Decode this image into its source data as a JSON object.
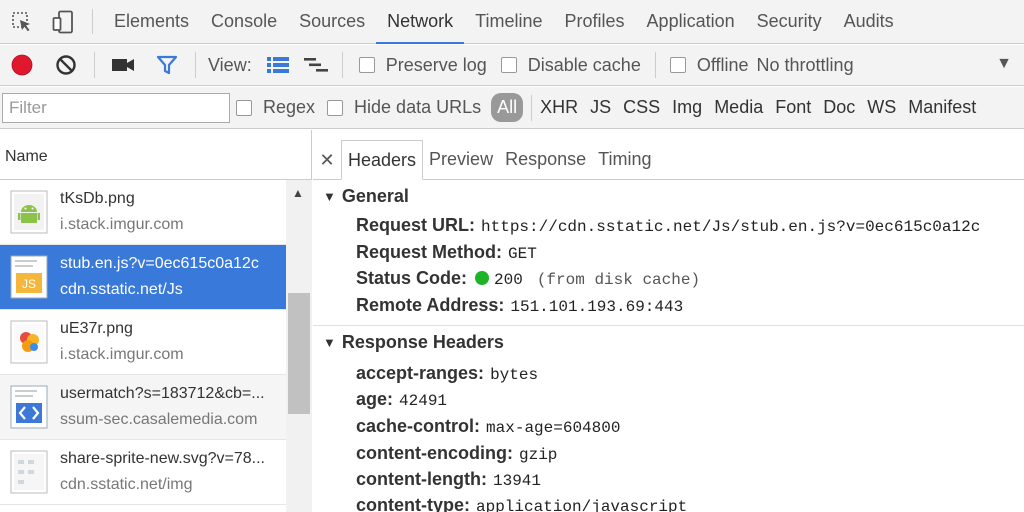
{
  "main_tabs": [
    "Elements",
    "Console",
    "Sources",
    "Network",
    "Timeline",
    "Profiles",
    "Application",
    "Security",
    "Audits"
  ],
  "toolbar": {
    "view_label": "View:",
    "preserve_log": "Preserve log",
    "disable_cache": "Disable cache",
    "offline": "Offline",
    "throttling": "No throttling"
  },
  "filter": {
    "placeholder": "Filter",
    "regex": "Regex",
    "hide_data_urls": "Hide data URLs",
    "all": "All",
    "types": [
      "XHR",
      "JS",
      "CSS",
      "Img",
      "Media",
      "Font",
      "Doc",
      "WS",
      "Manifest"
    ]
  },
  "list": {
    "header": "Name",
    "items": [
      {
        "name": "tKsDb.png",
        "domain": "i.stack.imgur.com",
        "icon": "android-image-icon"
      },
      {
        "name": "stub.en.js?v=0ec615c0a12c",
        "domain": "cdn.sstatic.net/Js",
        "icon": "js-file-icon"
      },
      {
        "name": "uE37r.png",
        "domain": "i.stack.imgur.com",
        "icon": "colorful-image-icon"
      },
      {
        "name": "usermatch?s=183712&cb=...",
        "domain": "ssum-sec.casalemedia.com",
        "icon": "code-file-icon"
      },
      {
        "name": "share-sprite-new.svg?v=78...",
        "domain": "cdn.sstatic.net/img",
        "icon": "svg-file-icon"
      }
    ]
  },
  "detail": {
    "tabs": [
      "Headers",
      "Preview",
      "Response",
      "Timing"
    ],
    "general": {
      "title": "General",
      "request_url_key": "Request URL:",
      "request_url": "https://cdn.sstatic.net/Js/stub.en.js?v=0ec615c0a12c",
      "method_key": "Request Method:",
      "method": "GET",
      "status_key": "Status Code:",
      "status": "200",
      "status_note": "(from disk cache)",
      "remote_key": "Remote Address:",
      "remote": "151.101.193.69:443"
    },
    "response_headers": {
      "title": "Response Headers",
      "items": [
        {
          "k": "accept-ranges:",
          "v": "bytes"
        },
        {
          "k": "age:",
          "v": "42491"
        },
        {
          "k": "cache-control:",
          "v": "max-age=604800"
        },
        {
          "k": "content-encoding:",
          "v": "gzip"
        },
        {
          "k": "content-length:",
          "v": "13941"
        },
        {
          "k": "content-type:",
          "v": "application/javascript"
        }
      ]
    }
  },
  "colors": {
    "accent": "#3879d9",
    "record": "#e0182e",
    "status_ok": "#1fb428"
  }
}
